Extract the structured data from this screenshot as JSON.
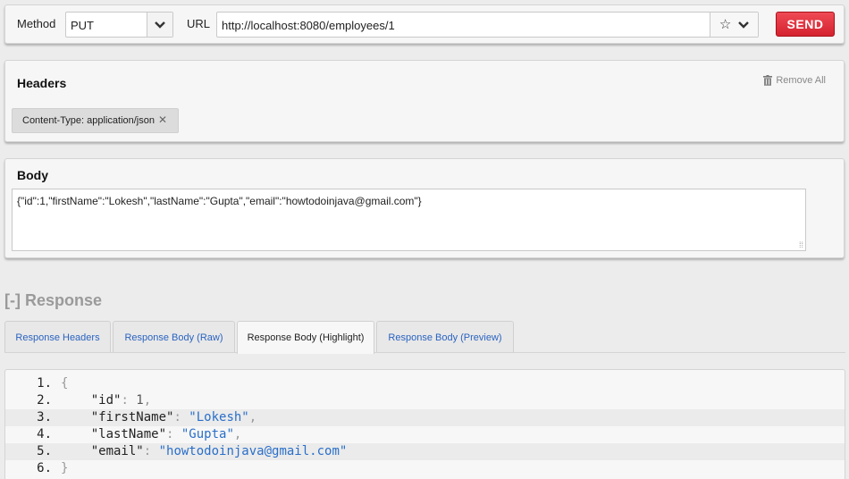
{
  "request": {
    "method_label": "Method",
    "method_value": "PUT",
    "url_label": "URL",
    "url_value": "http://localhost:8080/employees/1",
    "send_label": "SEND"
  },
  "headers": {
    "title": "Headers",
    "remove_all_label": "Remove All",
    "items": [
      {
        "text": "Content-Type: application/json"
      }
    ]
  },
  "body": {
    "title": "Body",
    "value": "{\"id\":1,\"firstName\":\"Lokesh\",\"lastName\":\"Gupta\",\"email\":\"howtodoinjava@gmail.com\"}"
  },
  "response": {
    "title": "[-] Response",
    "tabs": [
      {
        "label": "Response Headers",
        "active": false
      },
      {
        "label": "Response Body (Raw)",
        "active": false
      },
      {
        "label": "Response Body (Highlight)",
        "active": true
      },
      {
        "label": "Response Body (Preview)",
        "active": false
      }
    ],
    "code_lines": [
      {
        "num": "1.",
        "key": "",
        "value": "",
        "text": "{"
      },
      {
        "num": "2.",
        "key": "\"id\"",
        "value": "1",
        "text": ","
      },
      {
        "num": "3.",
        "key": "\"firstName\"",
        "value": "\"Lokesh\"",
        "text": ","
      },
      {
        "num": "4.",
        "key": "\"lastName\"",
        "value": "\"Gupta\"",
        "text": ","
      },
      {
        "num": "5.",
        "key": "\"email\"",
        "value": "\"howtodoinjava@gmail.com\"",
        "text": ""
      },
      {
        "num": "6.",
        "key": "",
        "value": "",
        "text": "}"
      }
    ]
  },
  "colors": {
    "send_button": "#e0313d",
    "link_blue": "#2a63c0",
    "string_blue": "#2a6fc9",
    "response_title_gray": "#9a9a9a"
  },
  "icons": [
    "chevron-down-icon",
    "star-icon",
    "trash-icon",
    "close-icon",
    "resize-handle-icon"
  ]
}
